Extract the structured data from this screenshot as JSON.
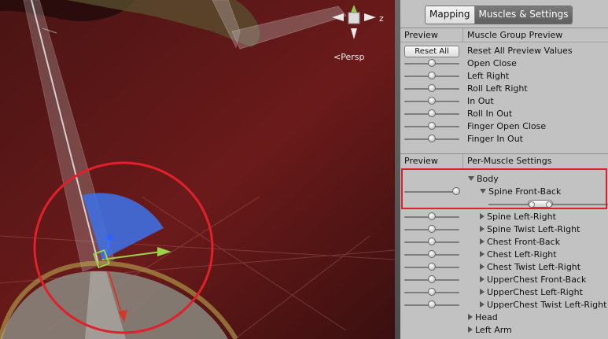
{
  "viewport": {
    "axis_label": "z",
    "projection_label": "Persp"
  },
  "tabs": [
    {
      "label": "Mapping",
      "active": false
    },
    {
      "label": "Muscles & Settings",
      "active": true
    }
  ],
  "muscle_group": {
    "col_preview": "Preview",
    "col_title": "Muscle Group Preview",
    "reset_button": "Reset All",
    "reset_label": "Reset All Preview Values",
    "items": [
      "Open Close",
      "Left Right",
      "Roll Left Right",
      "In Out",
      "Roll In Out",
      "Finger Open Close",
      "Finger In Out"
    ]
  },
  "per_muscle": {
    "col_preview": "Preview",
    "col_title": "Per-Muscle Settings",
    "body_label": "Body",
    "selected_label": "Spine Front-Back",
    "items": [
      "Spine Left-Right",
      "Spine Twist Left-Right",
      "Chest Front-Back",
      "Chest Left-Right",
      "Chest Twist Left-Right",
      "UpperChest Front-Back",
      "UpperChest Left-Right",
      "UpperChest Twist Left-Right"
    ],
    "groups": [
      "Head",
      "Left Arm"
    ]
  },
  "colors": {
    "highlight": "#e0202a",
    "annotation_circle": "#e0202a",
    "muscle_arc": "#3f6fe0",
    "tab_active": "#6a6a6a"
  }
}
